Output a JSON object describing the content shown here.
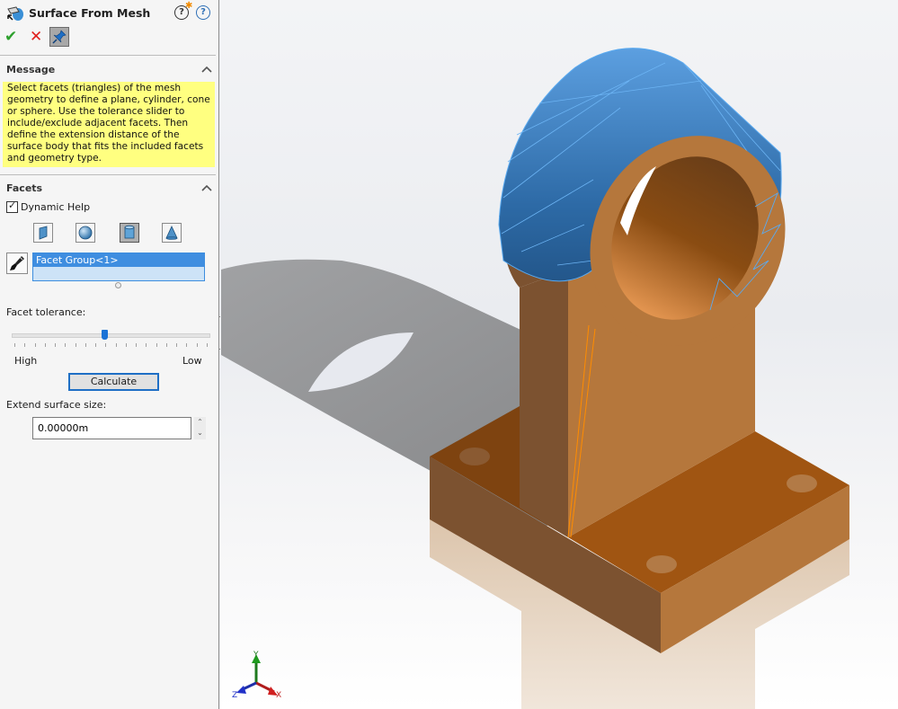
{
  "panel": {
    "title": "Surface From Mesh",
    "feature_icon": "surface-from-mesh-icon",
    "help_what_new_icon": "whats-new-help-icon",
    "help_icon": "help-icon",
    "ok_icon": "✔",
    "cancel_icon": "✕",
    "pin_icon": "pushpin-icon",
    "help_glyph": "?",
    "spark_glyph": "✱"
  },
  "message_group": {
    "title": "Message",
    "text": "Select facets (triangles) of the mesh geometry to define a plane, cylinder, cone or sphere.  Use the tolerance slider to include/exclude adjacent facets.  Then define the extension distance of the surface body that fits the included facets and geometry type."
  },
  "facets_group": {
    "title": "Facets",
    "dynamic_help_label": "Dynamic Help",
    "dynamic_help_checked": true,
    "check_glyph": "✓",
    "geometry_types": [
      {
        "name": "plane",
        "active": false
      },
      {
        "name": "sphere",
        "active": false
      },
      {
        "name": "cylinder",
        "active": true
      },
      {
        "name": "cone",
        "active": false
      }
    ],
    "selection_list": [
      "Facet Group<1>"
    ],
    "facet_tolerance_label": "Facet tolerance:",
    "slider_value_fraction": 0.47,
    "slider_min_label": "High",
    "slider_max_label": "Low",
    "slider_tick_count": 20,
    "calculate_label": "Calculate",
    "extend_label": "Extend surface size:",
    "extend_value": "0.00000m",
    "spin_up": "⌃",
    "spin_down": "⌄"
  },
  "viewport": {
    "triad": {
      "x_label": "X",
      "y_label": "Y",
      "z_label": "Z"
    },
    "colors": {
      "selected_facets": "#3f82c8",
      "facet_edges": "#5aaaf0",
      "part_copper": "#b5773c",
      "part_dark": "#7c5230",
      "part_top": "#a05512",
      "highlight_edge": "#ff8c00"
    }
  }
}
